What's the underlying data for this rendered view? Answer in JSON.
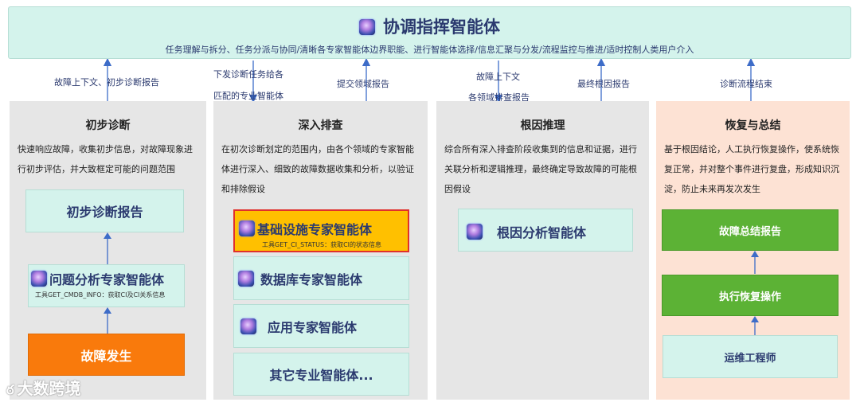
{
  "coordinator": {
    "title": "协调指挥智能体",
    "subtitle": "任务理解与拆分、任务分派与协同/清晰各专家智能体边界职能、进行智能体选择/信息汇聚与分发/流程监控与推进/适时控制人类用户介入"
  },
  "flow_labels": {
    "col1_up": "故障上下文、初步诊断报告",
    "col2_down_line1": "下发诊断任务给各",
    "col2_down_line2": "匹配的专业智能体",
    "col2_up": "提交领域报告",
    "col3_down_line1": "故障上下文",
    "col3_down_line2": "各领域排查报告",
    "col3_up": "最终根因报告",
    "col4_up": "诊断流程结束"
  },
  "col1": {
    "title": "初步诊断",
    "desc": "快速响应故障，收集初步信息，对故障现象进行初步评估，并大致框定可能的问题范围",
    "report": "初步诊断报告",
    "agent": "问题分析专家智能体",
    "agent_tool": "工具GET_CMDB_INFO：获取CI及CI关系信息",
    "event": "故障发生"
  },
  "col2": {
    "title": "深入排查",
    "desc": "在初次诊断划定的范围内，由各个领域的专家智能体进行深入、细致的故障数据收集和分析，以验证和排除假设",
    "agents": [
      {
        "label": "基础设施专家智能体",
        "tool": "工具GET_CI_STATUS：获取CI的状态信息"
      },
      {
        "label": "数据库专家智能体"
      },
      {
        "label": "应用专家智能体"
      },
      {
        "label": "其它专业智能体..."
      }
    ]
  },
  "col3": {
    "title": "根因推理",
    "desc": "综合所有深入排查阶段收集到的信息和证据，进行关联分析和逻辑推理，最终确定导致故障的可能根因假设",
    "agent": "根因分析智能体"
  },
  "col4": {
    "title": "恢复与总结",
    "desc": "基于根因结论，人工执行恢复操作，使系统恢复正常，并对整个事件进行复盘，形成知识沉淀，防止未来再发次发生",
    "summary": "故障总结报告",
    "recovery": "执行恢复操作",
    "engineer": "运维工程师"
  },
  "watermark": "大数跨境",
  "colors": {
    "mint": "#d4f3ec",
    "gray_panel": "#e6e6e6",
    "peach_panel": "#fde2d4",
    "orange": "#f97a0c",
    "gold": "#ffc000",
    "red_border": "#e0302c",
    "green": "#5cb235",
    "arrow_blue": "#3d6cc8",
    "text_navy": "#2b3a6f"
  },
  "icons": [
    "brain-icon",
    "arrow-up-icon",
    "arrow-down-icon"
  ]
}
